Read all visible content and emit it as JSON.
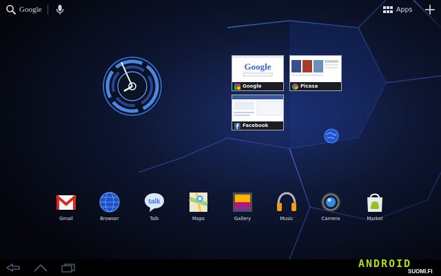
{
  "status_bar": {
    "search_label": "Google",
    "apps_label": "Apps"
  },
  "bookmarks": [
    {
      "label": "Google"
    },
    {
      "label": "Picasa"
    },
    {
      "label": "Facebook"
    }
  ],
  "google_thumb_logo": "Google",
  "dock": [
    {
      "label": "Gmail",
      "icon": "gmail-icon"
    },
    {
      "label": "Browser",
      "icon": "browser-icon"
    },
    {
      "label": "Talk",
      "icon": "talk-icon"
    },
    {
      "label": "Maps",
      "icon": "maps-icon"
    },
    {
      "label": "Gallery",
      "icon": "gallery-icon"
    },
    {
      "label": "Music",
      "icon": "music-icon"
    },
    {
      "label": "Camera",
      "icon": "camera-icon"
    },
    {
      "label": "Market",
      "icon": "market-icon"
    }
  ],
  "talk_icon_text": "talk",
  "watermark": {
    "logo": "ANDROID",
    "sub": "SUOMI.FI"
  },
  "colors": {
    "accent": "#3a7bff",
    "android_green": "#aee01d",
    "system_bar": "#000000"
  }
}
